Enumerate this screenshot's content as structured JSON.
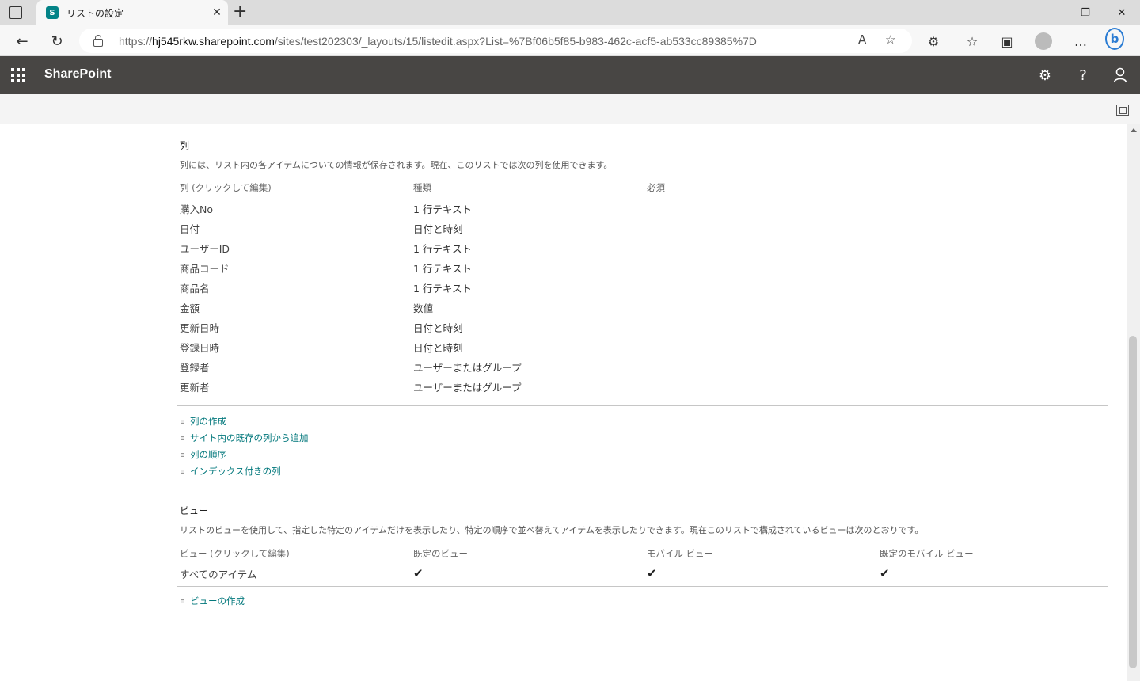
{
  "browser": {
    "tab_title": "リストの設定",
    "url_prefix": "https://",
    "url_host": "hj545rkw.sharepoint.com",
    "url_path": "/sites/test202303/_layouts/15/listedit.aspx?List=%7Bf06b5f85-b983-462c-acf5-ab533cc89385%7D"
  },
  "suite": {
    "title": "SharePoint"
  },
  "columns_section": {
    "title": "列",
    "description": "列には、リスト内の各アイテムについての情報が保存されます。現在、このリストでは次の列を使用できます。",
    "headers": {
      "name": "列 (クリックして編集)",
      "type": "種類",
      "required": "必須"
    },
    "rows": [
      {
        "name": "購入No",
        "type": "1 行テキスト"
      },
      {
        "name": "日付",
        "type": "日付と時刻"
      },
      {
        "name": "ユーザーID",
        "type": "1 行テキスト"
      },
      {
        "name": "商品コード",
        "type": "1 行テキスト"
      },
      {
        "name": "商品名",
        "type": "1 行テキスト"
      },
      {
        "name": "金額",
        "type": "数値"
      },
      {
        "name": "更新日時",
        "type": "日付と時刻"
      },
      {
        "name": "登録日時",
        "type": "日付と時刻"
      },
      {
        "name": "登録者",
        "type": "ユーザーまたはグループ"
      },
      {
        "name": "更新者",
        "type": "ユーザーまたはグループ"
      }
    ],
    "links": [
      "列の作成",
      "サイト内の既存の列から追加",
      "列の順序",
      "インデックス付きの列"
    ]
  },
  "views_section": {
    "title": "ビュー",
    "description": "リストのビューを使用して、指定した特定のアイテムだけを表示したり、特定の順序で並べ替えてアイテムを表示したりできます。現在このリストで構成されているビューは次のとおりです。",
    "headers": {
      "name": "ビュー (クリックして編集)",
      "default": "既定のビュー",
      "mobile": "モバイル ビュー",
      "default_mobile": "既定のモバイル ビュー"
    },
    "rows": [
      {
        "name": "すべてのアイテム",
        "default": "✔",
        "mobile": "✔",
        "default_mobile": "✔"
      }
    ],
    "links": [
      "ビューの作成"
    ]
  }
}
